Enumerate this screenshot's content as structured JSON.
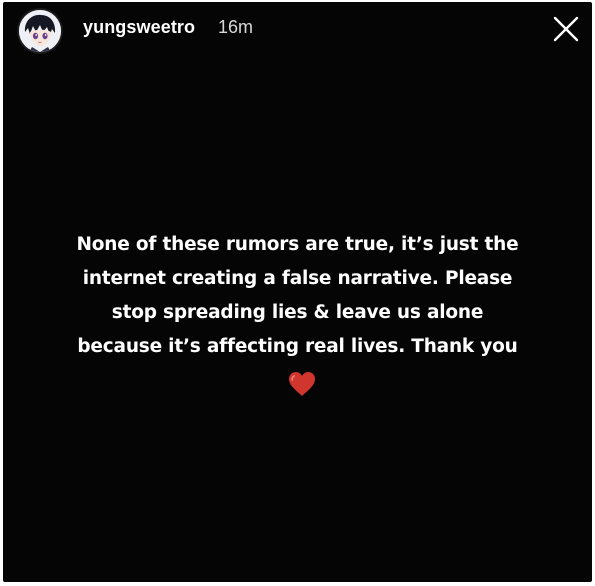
{
  "story": {
    "username": "yungsweetro",
    "time": "16m",
    "message_lines": [
      "None of these rumors are true, it’s just the",
      "internet creating a false narrative. Please",
      "stop spreading lies & leave us alone",
      "because it’s affecting real lives. Thank you"
    ],
    "icons": {
      "close": "close-icon",
      "heart": "heart-icon",
      "avatar": "anime-avatar-icon"
    },
    "colors": {
      "background": "#050505",
      "text": "#ffffff",
      "heart": "#d0352e"
    }
  }
}
